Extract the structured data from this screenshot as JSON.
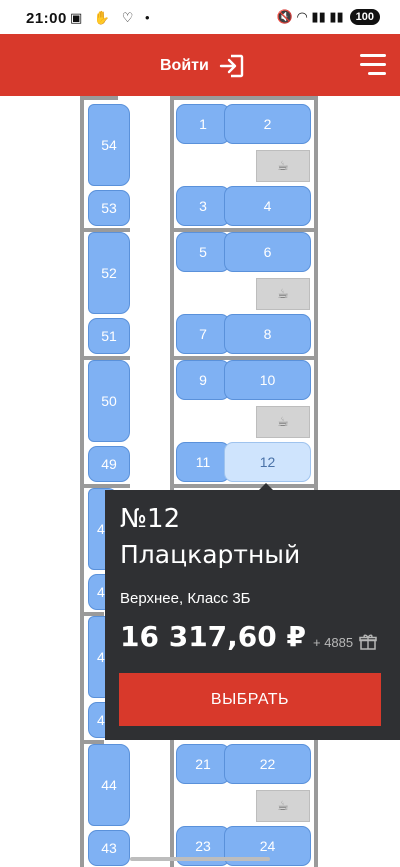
{
  "status_bar": {
    "time": "21:00",
    "left_icons": "▣ ✋ ♡ •",
    "right_icons": "🔇 ◠ ▮▮ ▮▮",
    "battery": "100"
  },
  "header": {
    "login_label": "Войти",
    "accent_color": "#d8392b"
  },
  "seats": {
    "side": [
      "54",
      "53",
      "52",
      "51",
      "50",
      "49",
      "4",
      "4",
      "4",
      "4",
      "44",
      "43"
    ],
    "compartment": [
      "1",
      "2",
      "3",
      "4",
      "5",
      "6",
      "7",
      "8",
      "9",
      "10",
      "11",
      "12",
      "21",
      "22",
      "23",
      "24"
    ],
    "selected": "12",
    "tea_icon": "☕"
  },
  "popup": {
    "number": "№12",
    "car_type": "Плацкартный",
    "seat_class": "Верхнее, Класс 3Б",
    "price": "16 317,60 ₽",
    "bonus": "+ 4885",
    "choose_label": "ВЫБРАТЬ"
  }
}
